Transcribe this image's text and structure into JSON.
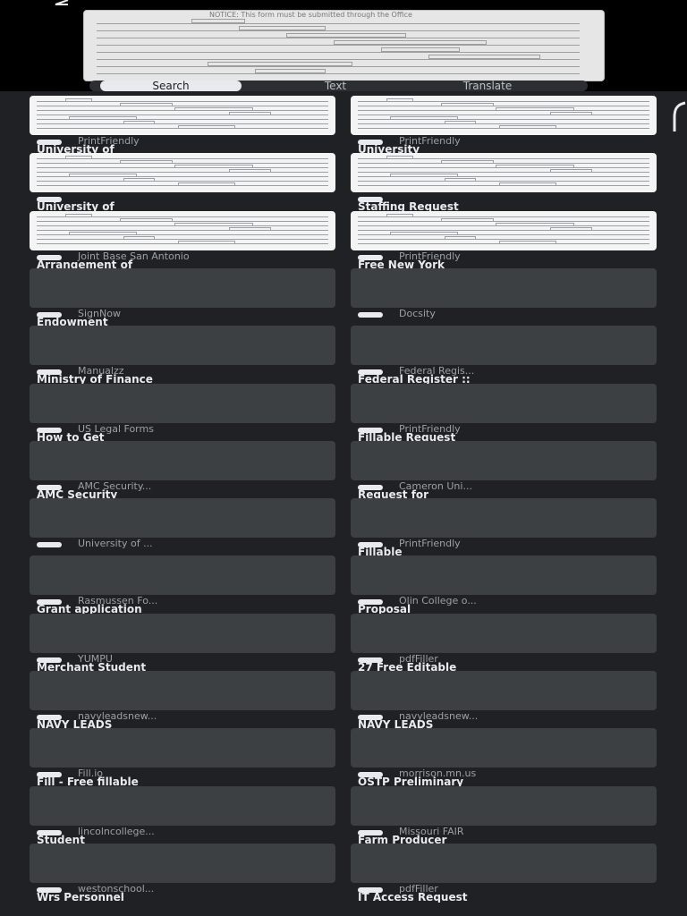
{
  "preview": {
    "header_text": "NOTICE: This form must be submitted through the Office"
  },
  "tabs": [
    {
      "label": "Search",
      "active": true
    },
    {
      "label": "Text",
      "active": false
    },
    {
      "label": "Translate",
      "active": false
    }
  ],
  "results_left": [
    {
      "source": "PrintFriendly",
      "title": "University of",
      "thumb": "light"
    },
    {
      "source": "",
      "title": "University of",
      "thumb": "light"
    },
    {
      "source": "Joint Base San Antonio",
      "title": "Arrangement of",
      "thumb": "light"
    },
    {
      "source": "SignNow",
      "title": "Endowment",
      "thumb": "dark"
    },
    {
      "source": "Manualzz",
      "title": "Ministry of Finance",
      "thumb": "dark"
    },
    {
      "source": "US Legal Forms",
      "title": "How to Get",
      "thumb": "dark"
    },
    {
      "source": "AMC Security...",
      "title": "AMC Security",
      "thumb": "dark"
    },
    {
      "source": "University of ...",
      "title": "",
      "thumb": "dark"
    },
    {
      "source": "Rasmussen Fo...",
      "title": "Grant application",
      "thumb": "dark"
    },
    {
      "source": "YUMPU",
      "title": "Merchant Student",
      "thumb": "dark"
    },
    {
      "source": "navyleadsnew...",
      "title": "NAVY LEADS",
      "thumb": "dark"
    },
    {
      "source": "Fill.io",
      "title": "Fill - Free fillable",
      "thumb": "dark"
    },
    {
      "source": "lincolncollege...",
      "title": "Student",
      "thumb": "dark"
    },
    {
      "source": "westonschool...",
      "title": "Wrs Personnel",
      "thumb": "dark"
    }
  ],
  "results_right": [
    {
      "source": "PrintFriendly",
      "title": "University",
      "thumb": "light"
    },
    {
      "source": "",
      "title": "Staffing Request",
      "thumb": "light"
    },
    {
      "source": "PrintFriendly",
      "title": "Free New York",
      "thumb": "light"
    },
    {
      "source": "Docsity",
      "title": "",
      "thumb": "dark"
    },
    {
      "source": "Federal Regis...",
      "title": "Federal Register ::",
      "thumb": "dark"
    },
    {
      "source": "PrintFriendly",
      "title": "Fillable Request",
      "thumb": "dark"
    },
    {
      "source": "Cameron Uni...",
      "title": "Request for",
      "thumb": "dark"
    },
    {
      "source": "PrintFriendly",
      "title": "Fillable",
      "thumb": "dark"
    },
    {
      "source": "Olin College o...",
      "title": "Proposal",
      "thumb": "dark"
    },
    {
      "source": "pdfFiller",
      "title": "27 Free Editable",
      "thumb": "dark"
    },
    {
      "source": "navyleadsnew...",
      "title": "NAVY LEADS",
      "thumb": "dark"
    },
    {
      "source": "morrison.mn.us",
      "title": "OSTP Preliminary",
      "thumb": "dark"
    },
    {
      "source": "Missouri FAIR",
      "title": "Farm Producer",
      "thumb": "dark"
    },
    {
      "source": "pdfFiller",
      "title": "IT Access Request",
      "thumb": "dark"
    }
  ]
}
